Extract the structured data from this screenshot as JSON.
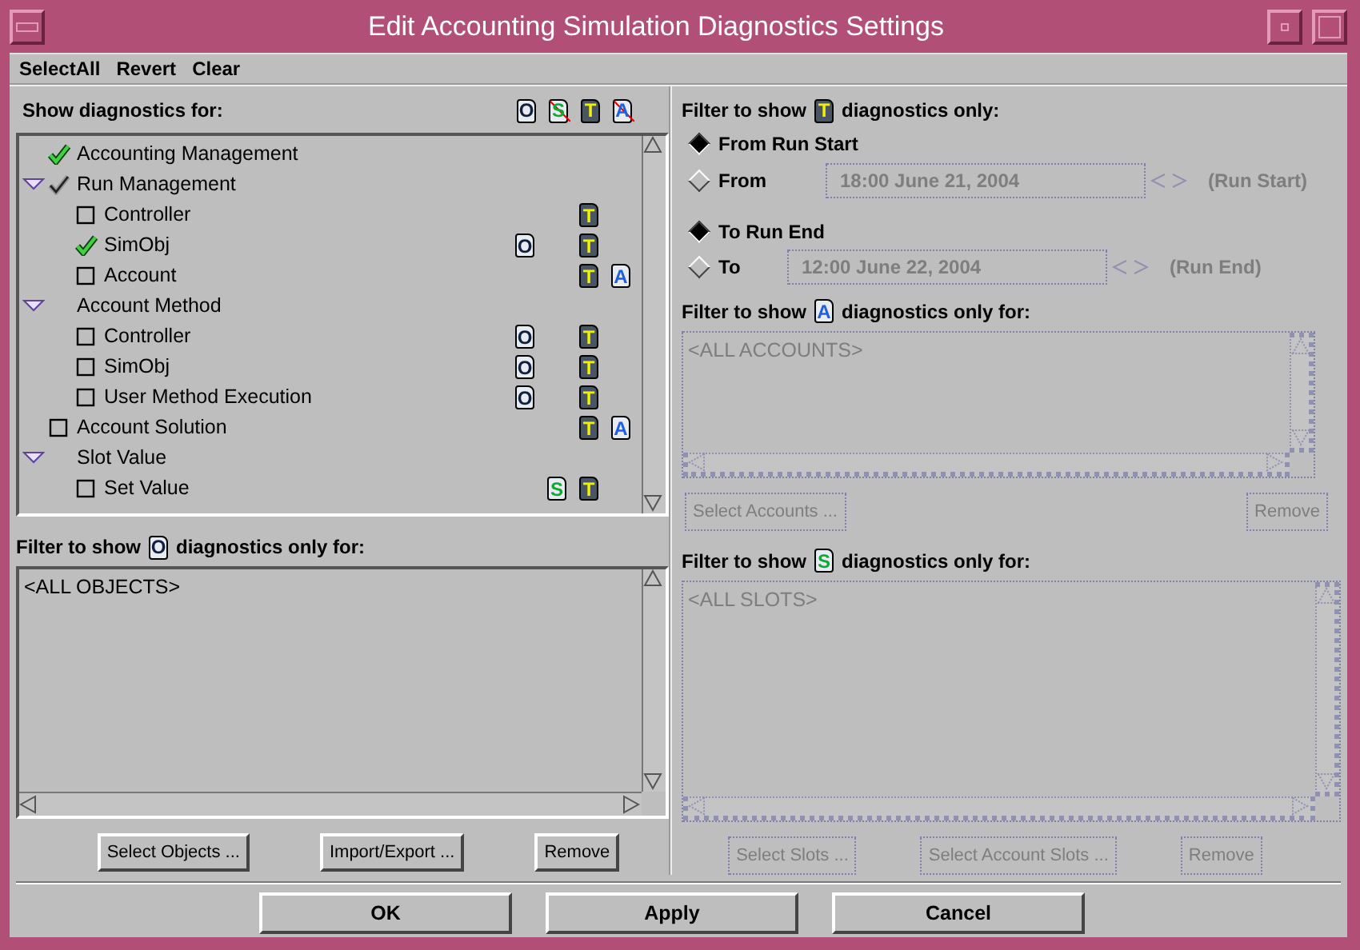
{
  "window": {
    "title": "Edit Accounting Simulation Diagnostics Settings"
  },
  "menu": [
    {
      "label": "SelectAll"
    },
    {
      "label": "Revert"
    },
    {
      "label": "Clear"
    }
  ],
  "diagnostics_panel": {
    "heading": "Show diagnostics for:",
    "types": {
      "object": {
        "letter": "O",
        "color": "#102040",
        "enabled": true
      },
      "slot": {
        "letter": "S",
        "color": "#10a830",
        "enabled": false
      },
      "timestep": {
        "letter": "T",
        "color": "#f0f000",
        "enabled": true
      },
      "account": {
        "letter": "A",
        "color": "#2060e0",
        "enabled": false
      }
    },
    "tree": [
      {
        "label": "Accounting Management",
        "kind": "checkbox",
        "checked": true
      },
      {
        "label": "Run Management",
        "kind": "checkbox",
        "checked": true,
        "mixed": true,
        "expanded": true,
        "children": [
          {
            "label": "Controller",
            "kind": "checkbox",
            "checked": false,
            "diagnostics": {
              "timestep": {
                "letter": "T"
              }
            }
          },
          {
            "label": "SimObj",
            "kind": "checkbox",
            "checked": true,
            "diagnostics": {
              "object": {
                "letter": "O"
              },
              "timestep": {
                "letter": "T"
              }
            }
          },
          {
            "label": "Account",
            "kind": "checkbox",
            "checked": false,
            "diagnostics": {
              "timestep": {
                "letter": "T"
              },
              "account": {
                "letter": "A"
              }
            }
          }
        ]
      },
      {
        "label": "Account Method",
        "kind": "group",
        "expanded": true,
        "children": [
          {
            "label": "Controller",
            "kind": "checkbox",
            "checked": false,
            "diagnostics": {
              "object": {
                "letter": "O"
              },
              "timestep": {
                "letter": "T"
              }
            }
          },
          {
            "label": "SimObj",
            "kind": "checkbox",
            "checked": false,
            "diagnostics": {
              "object": {
                "letter": "O"
              },
              "timestep": {
                "letter": "T"
              }
            }
          },
          {
            "label": "User Method Execution",
            "kind": "checkbox",
            "checked": false,
            "diagnostics": {
              "object": {
                "letter": "O"
              },
              "timestep": {
                "letter": "T"
              }
            }
          }
        ]
      },
      {
        "label": "Account Solution",
        "kind": "checkbox",
        "checked": false,
        "diagnostics": {
          "timestep": {
            "letter": "T"
          },
          "account": {
            "letter": "A"
          }
        }
      },
      {
        "label": "Slot Value",
        "kind": "group",
        "expanded": true,
        "children": [
          {
            "label": "Set Value",
            "kind": "checkbox",
            "checked": false,
            "diagnostics": {
              "slot": {
                "letter": "S"
              },
              "timestep": {
                "letter": "T"
              }
            }
          }
        ]
      }
    ]
  },
  "object_filter": {
    "heading_before": "Filter to show",
    "icon": {
      "letter": "O",
      "color": "#102040"
    },
    "heading_after": "diagnostics only for:",
    "disabled": false,
    "items": [
      "<ALL OBJECTS>"
    ],
    "buttons": [
      {
        "label": "Select Objects ...",
        "disabled": false
      },
      {
        "label": "Import/Export ...",
        "disabled": false
      },
      {
        "label": "Remove",
        "disabled": false
      }
    ]
  },
  "time_filter": {
    "heading_before": "Filter to show",
    "icon": {
      "letter": "T",
      "color": "#f0f000"
    },
    "heading_after": "diagnostics only:",
    "start_options": [
      {
        "label": "From Run Start",
        "selected": true
      },
      {
        "label": "From",
        "selected": false,
        "field": {
          "value": "18:00 June 21, 2004",
          "disabled": true
        },
        "note": "(Run Start)"
      }
    ],
    "end_options": [
      {
        "label": "To Run End",
        "selected": true
      },
      {
        "label": "To",
        "selected": false,
        "field": {
          "value": "12:00 June 22, 2004",
          "disabled": true
        },
        "note": "(Run End)"
      }
    ]
  },
  "account_filter": {
    "heading_before": "Filter to show",
    "icon": {
      "letter": "A",
      "color": "#2060e0"
    },
    "heading_after": "diagnostics only for:",
    "disabled": true,
    "items": [
      "<ALL ACCOUNTS>"
    ],
    "buttons": [
      {
        "label": "Select Accounts ...",
        "disabled": true
      },
      {
        "label": "Remove",
        "disabled": true
      }
    ]
  },
  "slot_filter": {
    "heading_before": "Filter to show",
    "icon": {
      "letter": "S",
      "color": "#10a830"
    },
    "heading_after": "diagnostics only for:",
    "disabled": true,
    "items": [
      "<ALL SLOTS>"
    ],
    "buttons": [
      {
        "label": "Select Slots ...",
        "disabled": true
      },
      {
        "label": "Select Account Slots ...",
        "disabled": true
      },
      {
        "label": "Remove",
        "disabled": true
      }
    ]
  },
  "dialog_buttons": [
    {
      "label": "OK"
    },
    {
      "label": "Apply"
    },
    {
      "label": "Cancel"
    }
  ]
}
